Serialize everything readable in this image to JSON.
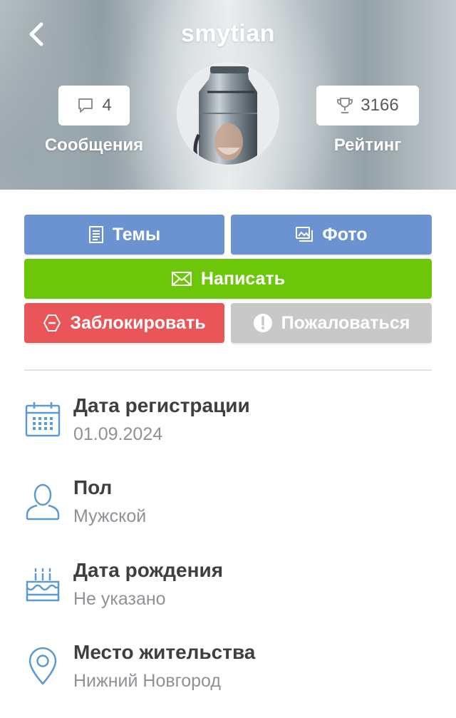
{
  "header": {
    "username": "smytian",
    "messages": {
      "count": "4",
      "label": "Сообщения",
      "icon": "chat-bubble-icon"
    },
    "rating": {
      "value": "3166",
      "label": "Рейтинг",
      "icon": "trophy-icon"
    },
    "back_icon": "chevron-left-icon"
  },
  "actions": {
    "topics": "Темы",
    "photo": "Фото",
    "write": "Написать",
    "block": "Заблокировать",
    "report": "Пожаловаться"
  },
  "info": {
    "registration": {
      "title": "Дата регистрации",
      "value": "01.09.2024",
      "icon": "calendar-icon"
    },
    "gender": {
      "title": "Пол",
      "value": "Мужской",
      "icon": "person-icon"
    },
    "birthday": {
      "title": "Дата рождения",
      "value": "Не указано",
      "icon": "cake-icon"
    },
    "city": {
      "title": "Место жительства",
      "value": "Нижний Новгород",
      "icon": "location-pin-icon"
    }
  },
  "colors": {
    "blue_button": "#6b93d2",
    "green_button": "#6cc60a",
    "red_button": "#e95559",
    "gray_button": "#c8c8c8",
    "icon_blue": "#5b9bd5",
    "title_text": "#3d4043",
    "value_text": "#8e9296"
  }
}
